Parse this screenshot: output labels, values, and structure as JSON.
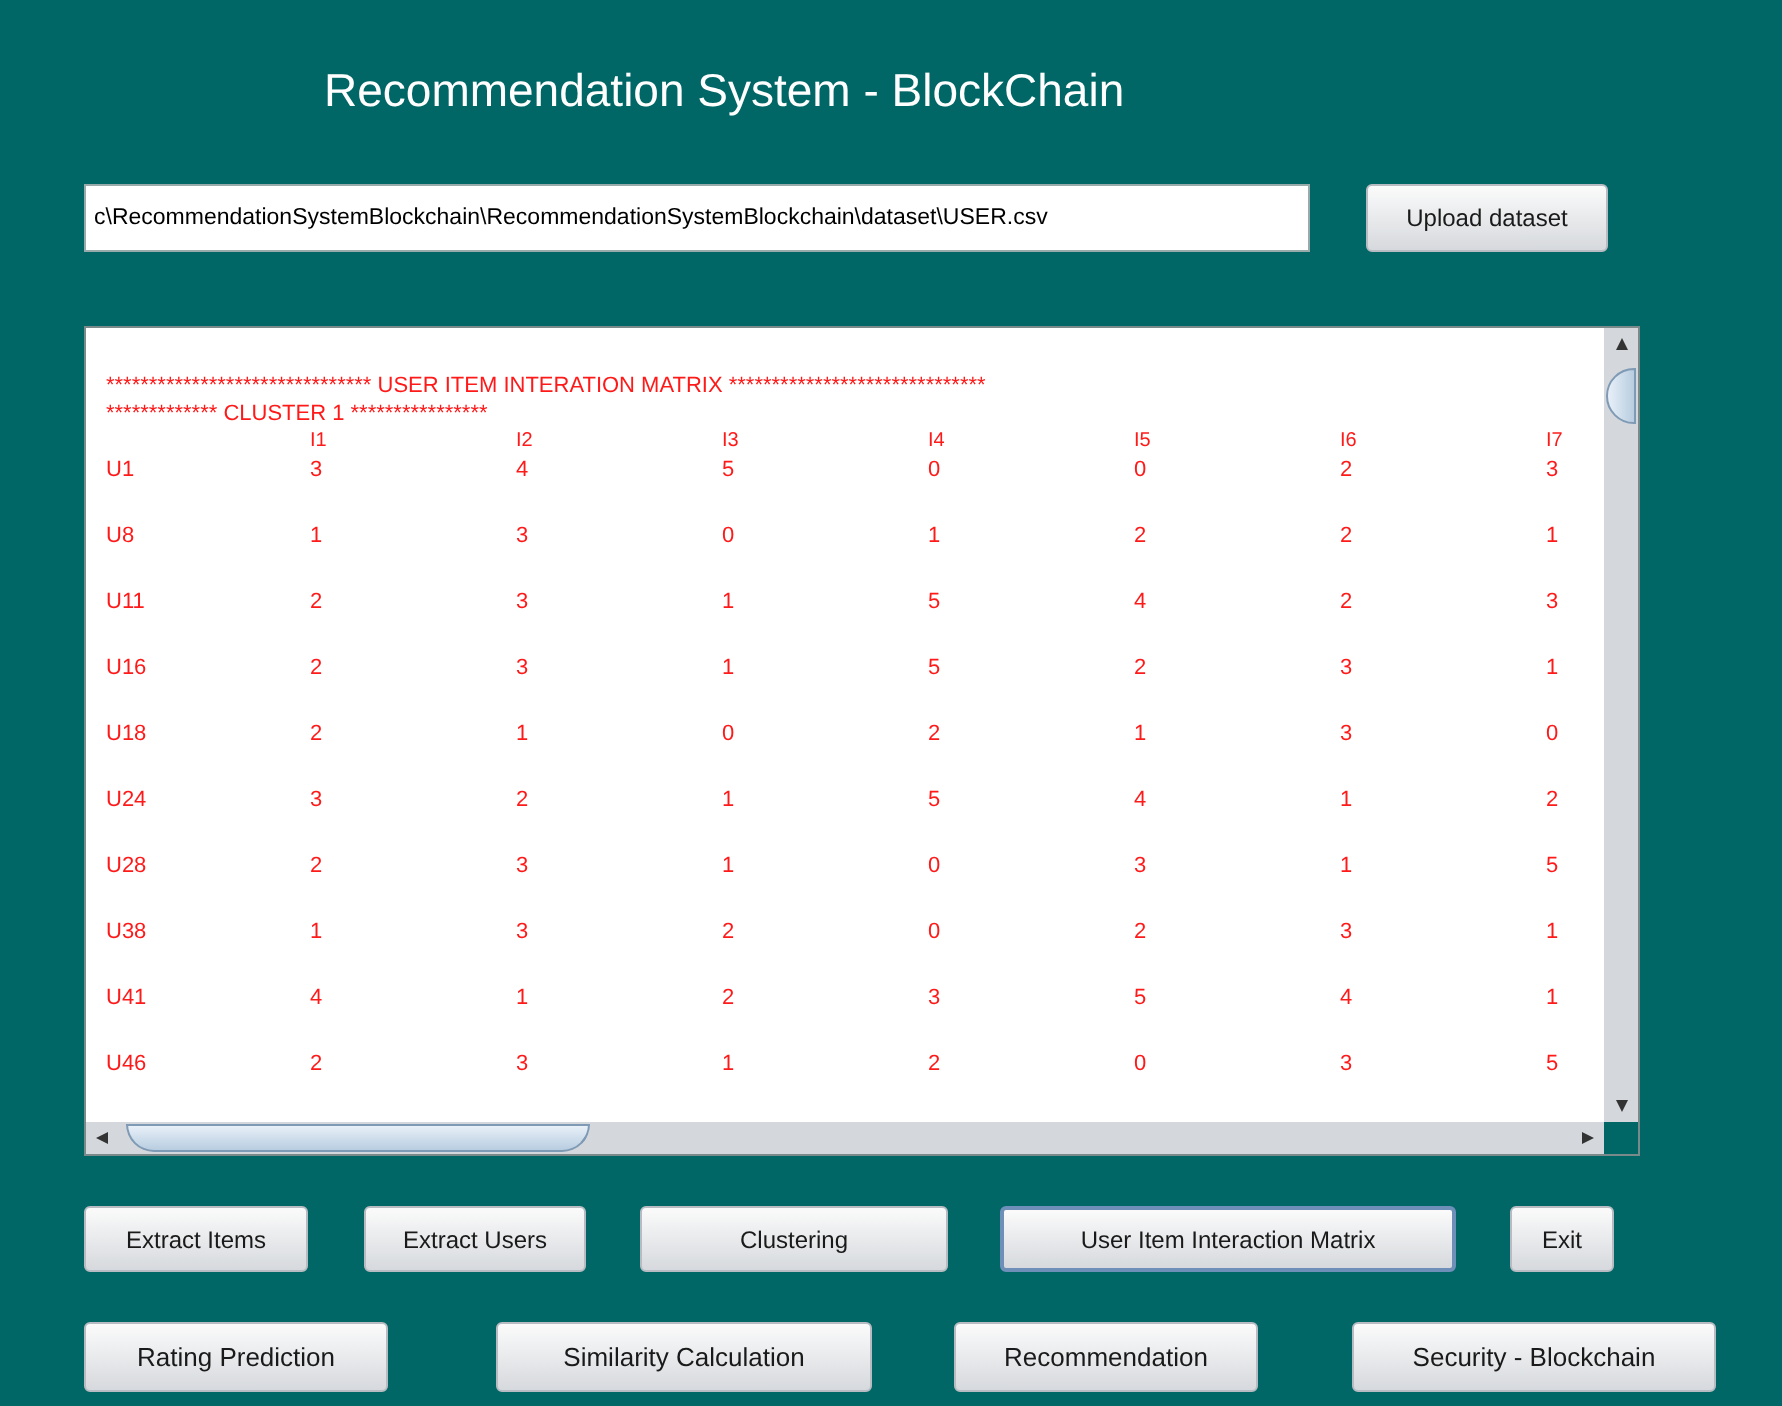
{
  "window": {
    "title": "Recommendation System - BlockChain"
  },
  "dataset": {
    "value": "c\\RecommendationSystemBlockchain\\RecommendationSystemBlockchain\\dataset\\USER.csv",
    "button": "Upload dataset"
  },
  "output": {
    "heading": "******************************* USER ITEM INTERATION MATRIX ******************************",
    "cluster": "************* CLUSTER 1 ****************",
    "columns": [
      "I1",
      "I2",
      "I3",
      "I4",
      "I5",
      "I6",
      "I7"
    ],
    "rows": [
      {
        "user": "U1",
        "values": [
          "3",
          "4",
          "5",
          "0",
          "0",
          "2",
          "3"
        ]
      },
      {
        "user": "U8",
        "values": [
          "1",
          "3",
          "0",
          "1",
          "2",
          "2",
          "1"
        ]
      },
      {
        "user": "U11",
        "values": [
          "2",
          "3",
          "1",
          "5",
          "4",
          "2",
          "3"
        ]
      },
      {
        "user": "U16",
        "values": [
          "2",
          "3",
          "1",
          "5",
          "2",
          "3",
          "1"
        ]
      },
      {
        "user": "U18",
        "values": [
          "2",
          "1",
          "0",
          "2",
          "1",
          "3",
          "0"
        ]
      },
      {
        "user": "U24",
        "values": [
          "3",
          "2",
          "1",
          "5",
          "4",
          "1",
          "2"
        ]
      },
      {
        "user": "U28",
        "values": [
          "2",
          "3",
          "1",
          "0",
          "3",
          "1",
          "5"
        ]
      },
      {
        "user": "U38",
        "values": [
          "1",
          "3",
          "2",
          "0",
          "2",
          "3",
          "1"
        ]
      },
      {
        "user": "U41",
        "values": [
          "4",
          "1",
          "2",
          "3",
          "5",
          "4",
          "1"
        ]
      },
      {
        "user": "U46",
        "values": [
          "2",
          "3",
          "1",
          "2",
          "0",
          "3",
          "5"
        ]
      }
    ]
  },
  "buttons_row_1": [
    {
      "label": "Extract Items",
      "selected": false
    },
    {
      "label": "Extract Users",
      "selected": false
    },
    {
      "label": "Clustering",
      "selected": false
    },
    {
      "label": "User Item Interaction Matrix",
      "selected": true
    },
    {
      "label": "Exit",
      "selected": false
    }
  ],
  "buttons_row_2": [
    {
      "label": "Rating Prediction",
      "selected": false
    },
    {
      "label": "Similarity Calculation",
      "selected": false
    },
    {
      "label": "Recommendation",
      "selected": false
    },
    {
      "label": "Security - Blockchain",
      "selected": false
    }
  ]
}
